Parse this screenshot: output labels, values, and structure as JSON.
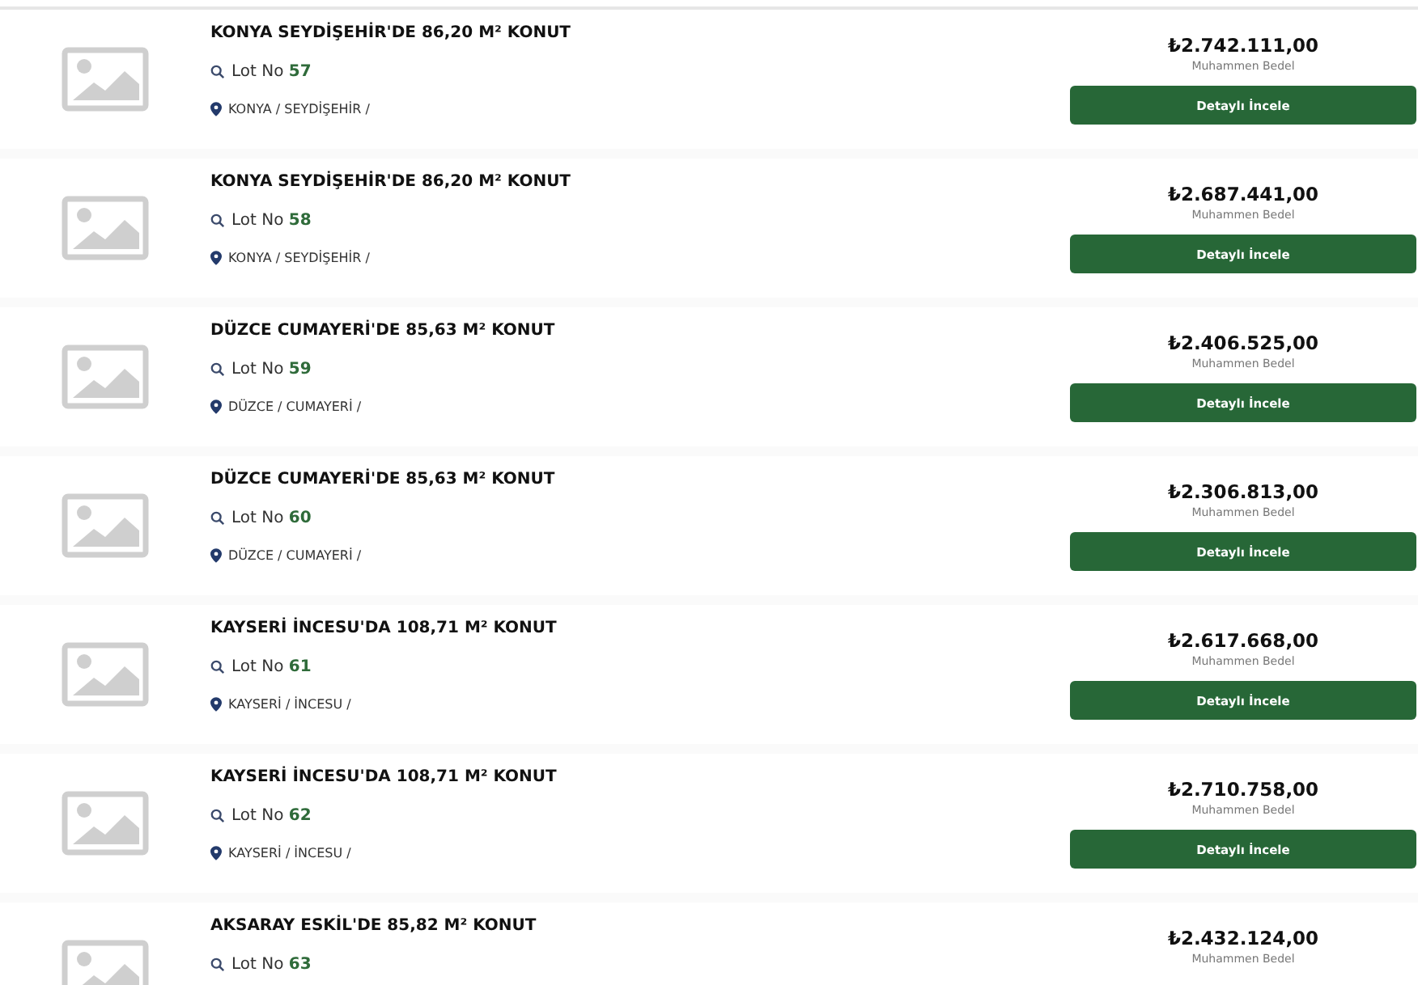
{
  "listings": [
    {
      "title": "KONYA SEYDİŞEHİR'DE 86,20 M² KONUT",
      "lot_label": "Lot No",
      "lot_number": "57",
      "location": "KONYA / SEYDİŞEHİR /",
      "price": "₺2.742.111,00",
      "price_label": "Muhammen Bedel",
      "button": "Detaylı İncele"
    },
    {
      "title": "KONYA SEYDİŞEHİR'DE 86,20 M² KONUT",
      "lot_label": "Lot No",
      "lot_number": "58",
      "location": "KONYA / SEYDİŞEHİR /",
      "price": "₺2.687.441,00",
      "price_label": "Muhammen Bedel",
      "button": "Detaylı İncele"
    },
    {
      "title": "DÜZCE CUMAYERİ'DE 85,63 M² KONUT",
      "lot_label": "Lot No",
      "lot_number": "59",
      "location": "DÜZCE / CUMAYERİ /",
      "price": "₺2.406.525,00",
      "price_label": "Muhammen Bedel",
      "button": "Detaylı İncele"
    },
    {
      "title": "DÜZCE CUMAYERİ'DE 85,63 M² KONUT",
      "lot_label": "Lot No",
      "lot_number": "60",
      "location": "DÜZCE / CUMAYERİ /",
      "price": "₺2.306.813,00",
      "price_label": "Muhammen Bedel",
      "button": "Detaylı İncele"
    },
    {
      "title": "KAYSERİ İNCESU'DA 108,71 M² KONUT",
      "lot_label": "Lot No",
      "lot_number": "61",
      "location": "KAYSERİ / İNCESU /",
      "price": "₺2.617.668,00",
      "price_label": "Muhammen Bedel",
      "button": "Detaylı İncele"
    },
    {
      "title": "KAYSERİ İNCESU'DA 108,71 M² KONUT",
      "lot_label": "Lot No",
      "lot_number": "62",
      "location": "KAYSERİ / İNCESU /",
      "price": "₺2.710.758,00",
      "price_label": "Muhammen Bedel",
      "button": "Detaylı İncele"
    },
    {
      "title": "AKSARAY ESKİL'DE 85,82 M² KONUT",
      "lot_label": "Lot No",
      "lot_number": "63",
      "price": "₺2.432.124,00",
      "price_label": "Muhammen Bedel"
    }
  ]
}
